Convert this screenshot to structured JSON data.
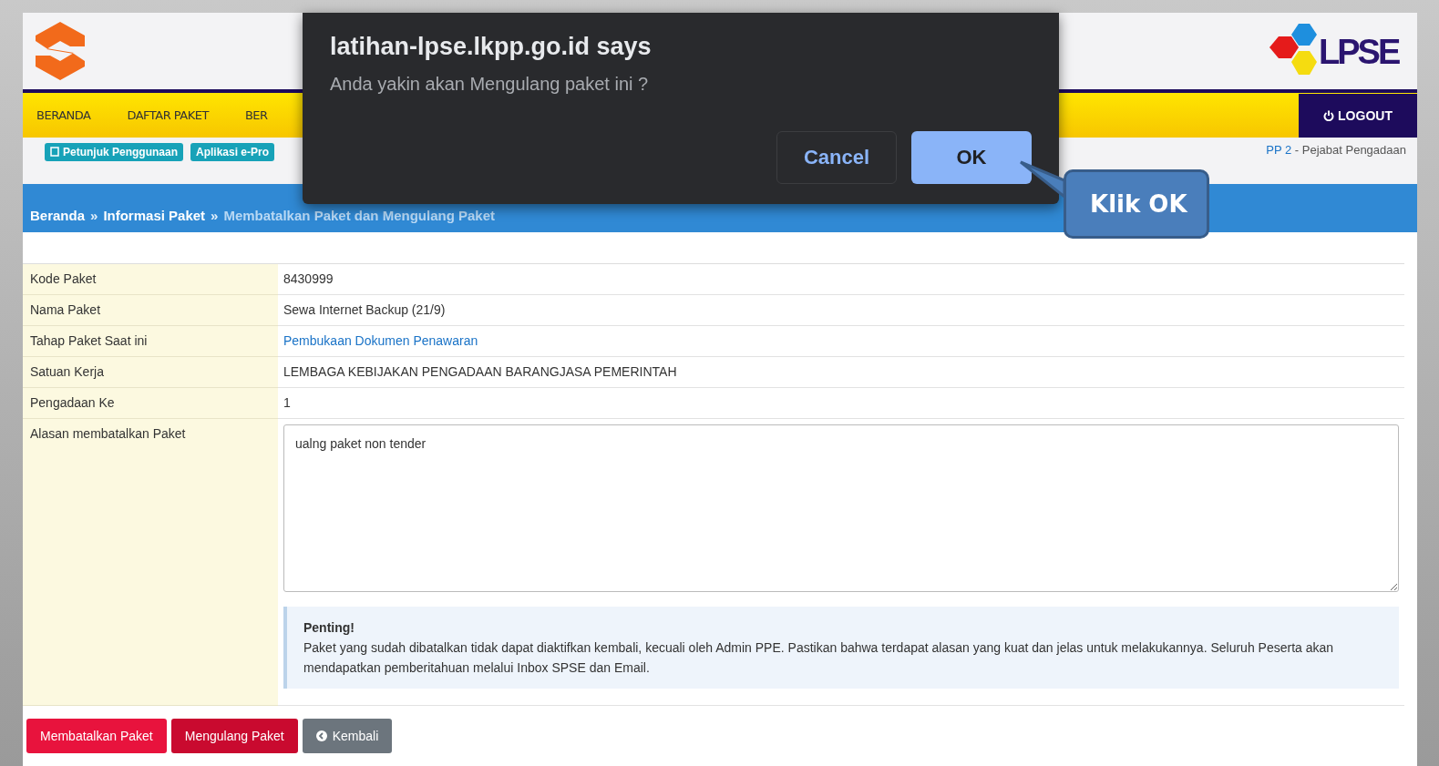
{
  "header": {
    "logo_text": "LPSE",
    "nav": [
      "BERANDA",
      "DAFTAR PAKET",
      "BER"
    ],
    "logout": "LOGOUT"
  },
  "subbar": {
    "links": [
      {
        "label": "Petunjuk Penggunaan",
        "kind": "icon"
      },
      {
        "label": "Aplikasi e-Pro",
        "kind": "plain"
      }
    ],
    "user_link": "PP 2",
    "user_role": " - Pejabat Pengadaan"
  },
  "breadcrumb": [
    {
      "label": "Beranda",
      "current": false
    },
    {
      "label": "Informasi Paket",
      "current": false
    },
    {
      "label": "Membatalkan Paket dan Mengulang Paket",
      "current": true
    }
  ],
  "breadcrumb_separator": "»",
  "rows": [
    {
      "label": "Kode Paket",
      "value": "8430999",
      "kind": "text"
    },
    {
      "label": "Nama Paket",
      "value": "Sewa Internet Backup (21/9)",
      "kind": "text"
    },
    {
      "label": "Tahap Paket Saat ini",
      "value": "Pembukaan Dokumen Penawaran",
      "kind": "link"
    },
    {
      "label": "Satuan Kerja",
      "value": "LEMBAGA KEBIJAKAN PENGADAAN BARANGJASA PEMERINTAH",
      "kind": "text"
    },
    {
      "label": "Pengadaan Ke",
      "value": "1",
      "kind": "text"
    },
    {
      "label": "Alasan membatalkan Paket",
      "value": "ualng paket non tender",
      "kind": "textarea"
    }
  ],
  "notice": {
    "title": "Penting!",
    "text": "Paket yang sudah dibatalkan tidak dapat diaktifkan kembali, kecuali oleh Admin PPE. Pastikan bahwa terdapat alasan yang kuat dan jelas untuk melakukannya. Seluruh Peserta akan mendapatkan pemberitahuan melalui Inbox SPSE dan Email."
  },
  "buttons": [
    {
      "label": "Membatalkan Paket",
      "kind": "danger"
    },
    {
      "label": "Mengulang Paket",
      "kind": "danger-dark"
    },
    {
      "label": "Kembali",
      "kind": "back"
    }
  ],
  "dialog": {
    "title": "latihan-lpse.lkpp.go.id says",
    "message": "Anda yakin akan Mengulang paket ini ?",
    "buttons": [
      {
        "label": "Cancel",
        "kind": "secondary"
      },
      {
        "label": "OK",
        "kind": "primary"
      }
    ]
  },
  "callout": "Klik OK"
}
